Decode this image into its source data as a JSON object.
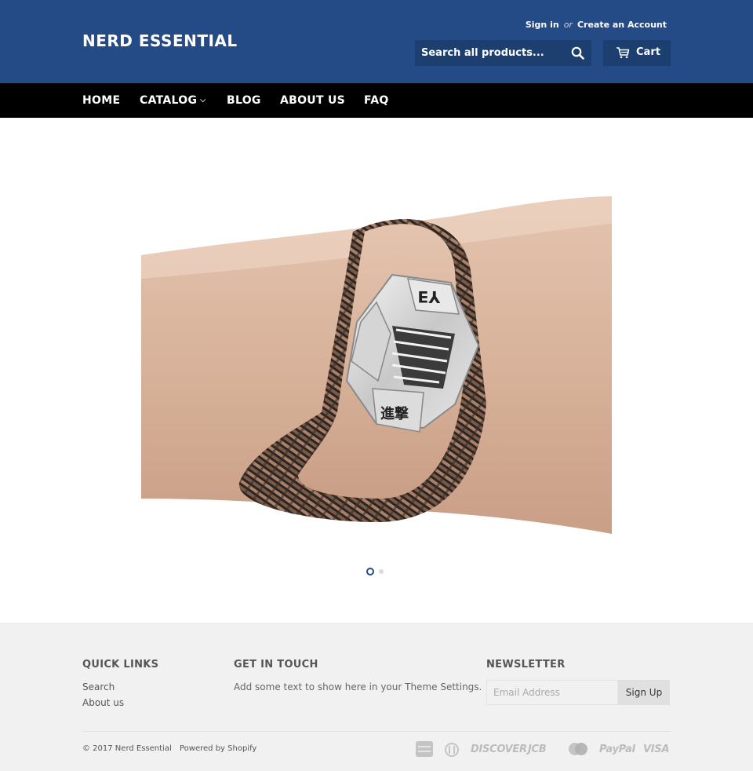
{
  "header": {
    "logo": "NERD ESSENTIAL",
    "sign_in": "Sign in",
    "or": "or",
    "create_account": "Create an Account",
    "search_placeholder": "Search all products...",
    "cart_label": "Cart",
    "search_icon": "search-icon",
    "cart_icon": "cart-icon"
  },
  "nav": {
    "items": [
      {
        "label": "HOME"
      },
      {
        "label": "CATALOG",
        "has_dropdown": true
      },
      {
        "label": "BLOG"
      },
      {
        "label": "ABOUT US"
      },
      {
        "label": "FAQ"
      }
    ]
  },
  "slideshow": {
    "slide_count": 2,
    "active_index": 0,
    "image": "attack-on-titan-survey-corps-leather-bracelet"
  },
  "footer": {
    "quick_links": {
      "title": "QUICK LINKS",
      "links": [
        "Search",
        "About us"
      ]
    },
    "get_in_touch": {
      "title": "GET IN TOUCH",
      "text": "Add some text to show here in your Theme Settings."
    },
    "newsletter": {
      "title": "NEWSLETTER",
      "placeholder": "Email Address",
      "button": "Sign Up"
    },
    "copyright": "© 2017 Nerd Essential",
    "powered_by": "Powered by Shopify",
    "payment_icons": [
      "american-express-icon",
      "diners-club-icon",
      "discover-icon",
      "jcb-icon",
      "master-icon",
      "paypal-icon",
      "visa-icon"
    ],
    "payment_labels": {
      "discover": "DISCOVER",
      "jcb": "JCB",
      "paypal": "PayPal",
      "visa": "VISA"
    }
  },
  "colors": {
    "header_bg": "#244b85",
    "nav_bg": "#000000",
    "footer_bg": "#f1f1f1"
  }
}
